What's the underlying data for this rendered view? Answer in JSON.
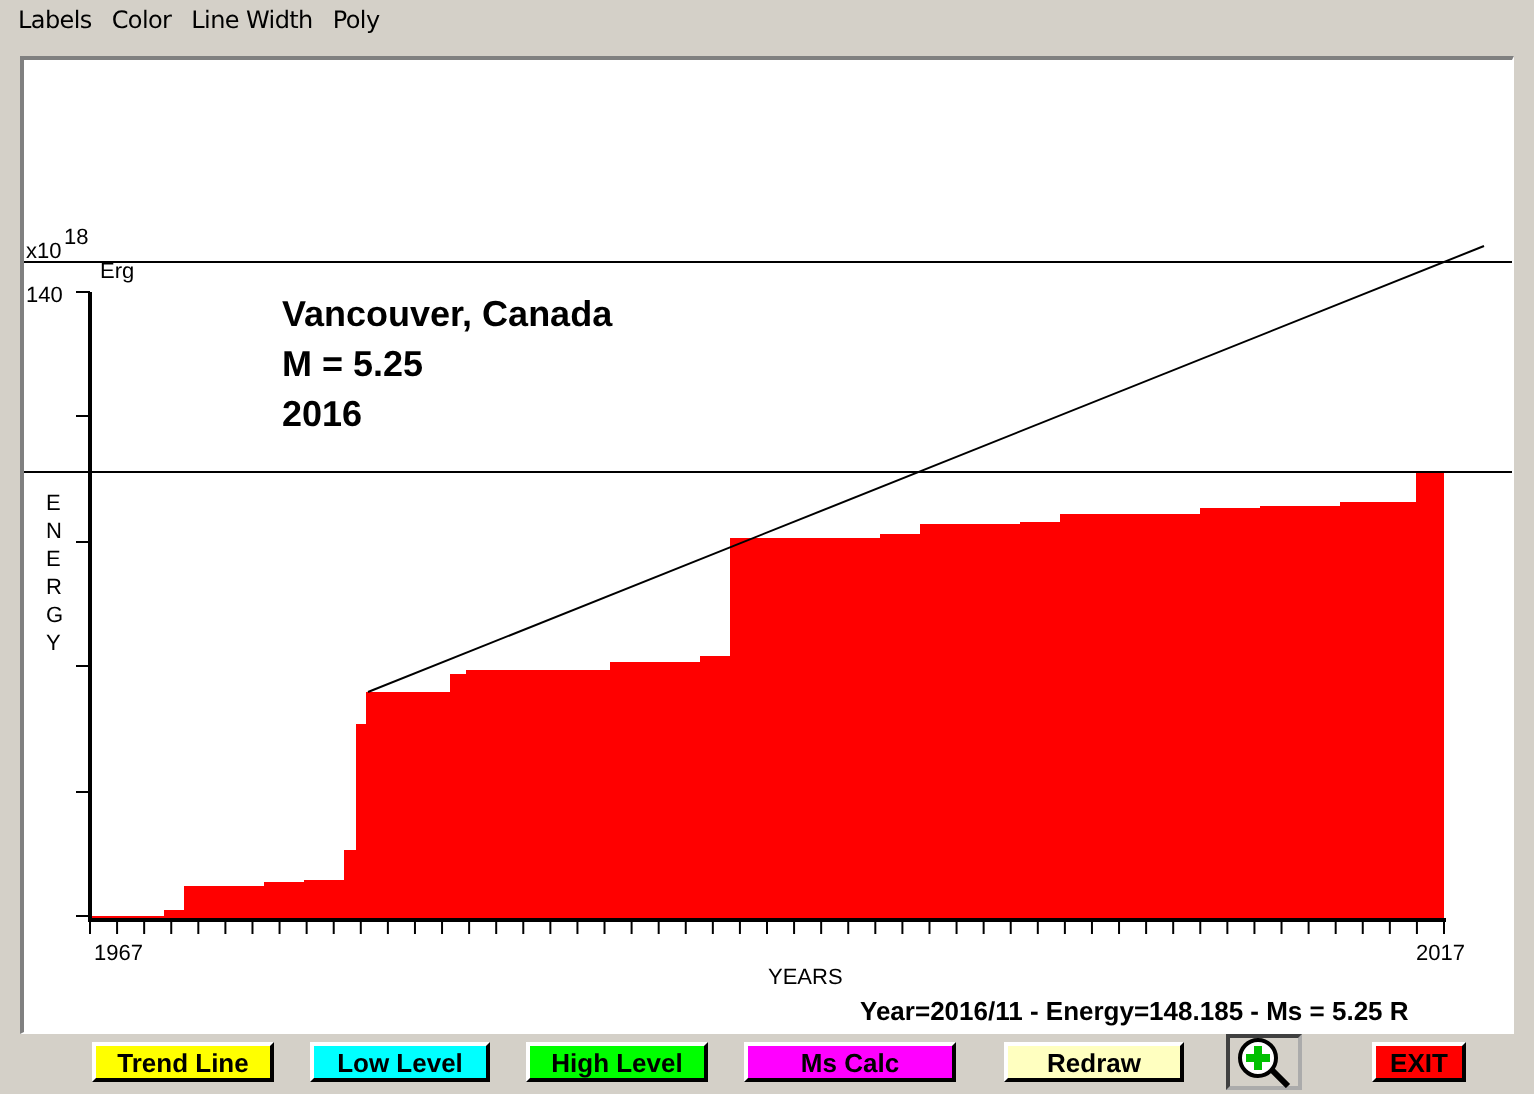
{
  "menu": [
    "Labels",
    "Color",
    "Line Width",
    "Poly"
  ],
  "plot": {
    "unit_prefix": "x10",
    "unit_exponent": "18",
    "unit": "Erg",
    "y_top_label": "140",
    "y_axis_label": "ENERGY",
    "x_start_label": "1967",
    "x_end_label": "2017",
    "x_axis_label": "YEARS",
    "title_lines": [
      "Vancouver, Canada",
      "M = 5.25",
      "2016"
    ],
    "readout": "Year=2016/11 - Energy=148.185 - Ms = 5.25 R"
  },
  "buttons": [
    {
      "kind": "text",
      "label": "Trend Line",
      "color": "#ffff00",
      "pressed": false
    },
    {
      "kind": "text",
      "label": "Low Level",
      "color": "#00ffff",
      "pressed": false
    },
    {
      "kind": "text",
      "label": "High Level",
      "color": "#00ff00",
      "pressed": false
    },
    {
      "kind": "text",
      "label": "Ms Calc",
      "color": "#ff00ff",
      "pressed": false
    },
    {
      "kind": "text",
      "label": "Redraw",
      "color": "#ffffc0",
      "pressed": false
    },
    {
      "kind": "zoom",
      "pressed": true
    },
    {
      "kind": "text",
      "label": "EXIT",
      "color": "#ff0000",
      "pressed": false
    }
  ]
}
